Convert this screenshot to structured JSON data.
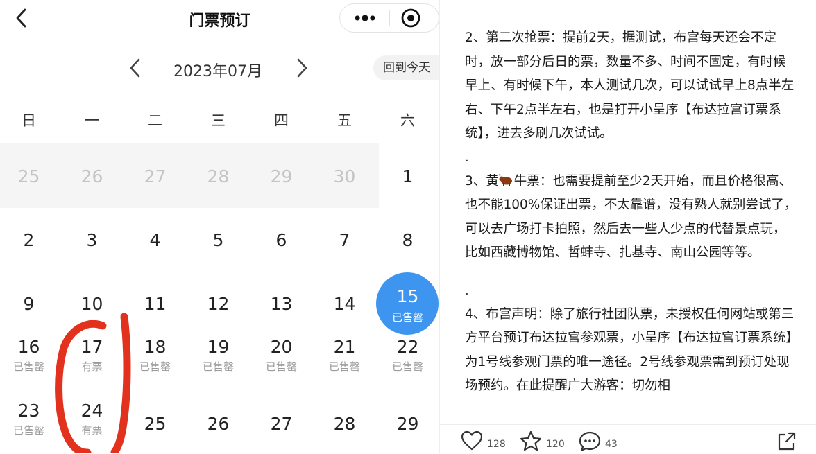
{
  "nav": {
    "title": "门票预订",
    "back_icon": "chevron-left-icon",
    "more_icon": "more-dots-icon",
    "close_icon": "target-circle-icon"
  },
  "calendar": {
    "month_label": "2023年07月",
    "today_button": "回到今天",
    "weekdays": [
      "日",
      "一",
      "二",
      "三",
      "四",
      "五",
      "六"
    ],
    "selected_color": "#3d95ef",
    "days": [
      {
        "num": "25",
        "status": ""
      },
      {
        "num": "26",
        "status": ""
      },
      {
        "num": "27",
        "status": ""
      },
      {
        "num": "28",
        "status": ""
      },
      {
        "num": "29",
        "status": ""
      },
      {
        "num": "30",
        "status": ""
      },
      {
        "num": "1",
        "status": ""
      },
      {
        "num": "2",
        "status": ""
      },
      {
        "num": "3",
        "status": ""
      },
      {
        "num": "4",
        "status": ""
      },
      {
        "num": "5",
        "status": ""
      },
      {
        "num": "6",
        "status": ""
      },
      {
        "num": "7",
        "status": ""
      },
      {
        "num": "8",
        "status": ""
      },
      {
        "num": "9",
        "status": ""
      },
      {
        "num": "10",
        "status": ""
      },
      {
        "num": "11",
        "status": ""
      },
      {
        "num": "12",
        "status": ""
      },
      {
        "num": "13",
        "status": ""
      },
      {
        "num": "14",
        "status": ""
      },
      {
        "num": "15",
        "status": "已售罄"
      },
      {
        "num": "16",
        "status": "已售罄"
      },
      {
        "num": "17",
        "status": "有票"
      },
      {
        "num": "18",
        "status": "已售罄"
      },
      {
        "num": "19",
        "status": "已售罄"
      },
      {
        "num": "20",
        "status": "已售罄"
      },
      {
        "num": "21",
        "status": "已售罄"
      },
      {
        "num": "22",
        "status": "已售罄"
      },
      {
        "num": "23",
        "status": "已售罄"
      },
      {
        "num": "24",
        "status": "有票"
      },
      {
        "num": "25",
        "status": ""
      },
      {
        "num": "26",
        "status": ""
      },
      {
        "num": "27",
        "status": ""
      },
      {
        "num": "28",
        "status": ""
      },
      {
        "num": "29",
        "status": ""
      }
    ],
    "markup_color": "#e2321e"
  },
  "post": {
    "p1": "2、第二次抢票：提前2天，据测试，布宫每天还会不定时，放一部分后日的票，数量不多、时间不固定，有时候早上、有时候下午，本人测试几次，可以试试早上8点半左右、下午2点半左右，也是打开小呈序【布达拉宫订票系统】，进去多刷几次试试。",
    "dot1": ".",
    "p2_prefix": "3、黄",
    "bull_icon": "bull-emoji-icon",
    "p2_rest": "牛票：也需要提前至少2天开始，而且价格很高、也不能100%保证出票，不太靠谱，没有熟人就别尝试了，可以去广场打卡拍照，然后去一些人少点的代替景点玩，比如西藏博物馆、哲蚌寺、扎基寺、南山公园等等。",
    "dot2": ".",
    "p3": "4、布宫声明：除了旅行社团队票，未授权任何网站或第三方平台预订布达拉宫参观票，小呈序【布达拉宫订票系统】为1号线参观门票的唯一途径。2号线参观票需到预订处现场预约。在此提醒广大游客：切勿相"
  },
  "actions": {
    "like_count": "128",
    "like_icon": "heart-outline-icon",
    "star_count": "120",
    "star_icon": "star-outline-icon",
    "comment_count": "43",
    "comment_icon": "comment-bubble-icon",
    "share_icon": "share-arrow-icon"
  }
}
